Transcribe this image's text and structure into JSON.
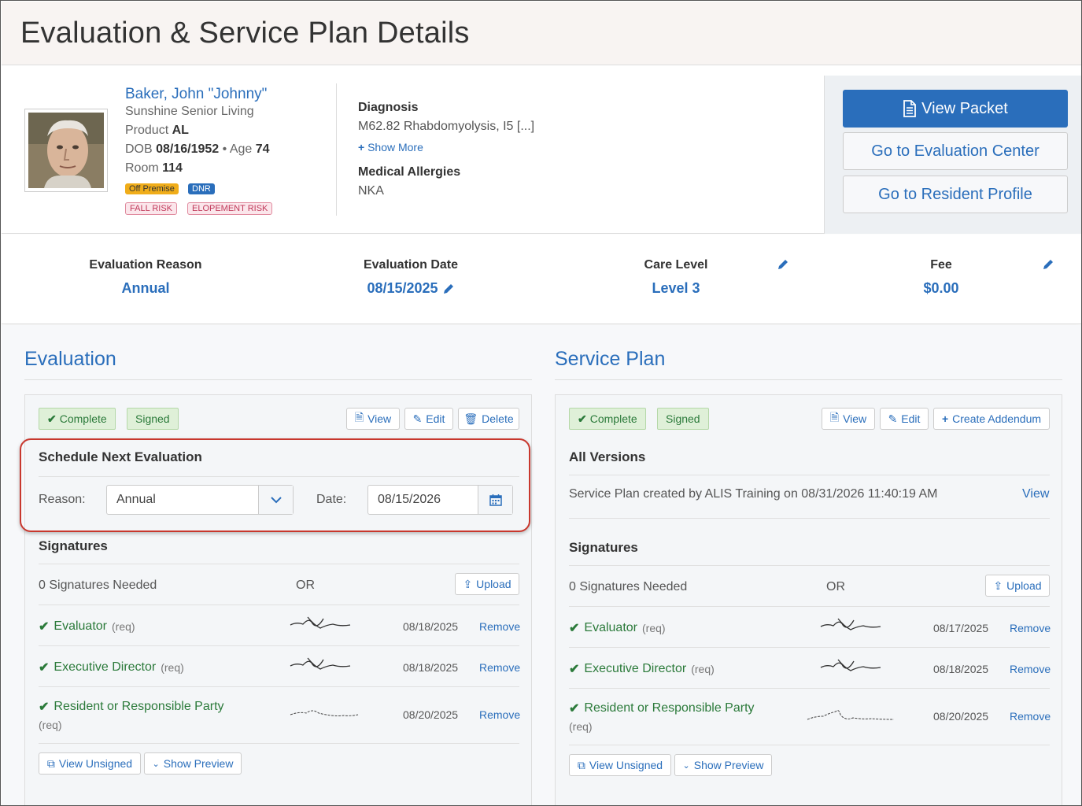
{
  "page": {
    "title": "Evaluation & Service Plan Details"
  },
  "resident": {
    "name": "Baker, John \"Johnny\"",
    "community": "Sunshine Senior Living",
    "product_label": "Product",
    "product": "AL",
    "dob_label": "DOB",
    "dob": "08/16/1952",
    "age_label": "Age",
    "age": "74",
    "room_label": "Room",
    "room": "114",
    "badges": [
      "Off Premise",
      "DNR",
      "FALL RISK",
      "ELOPEMENT RISK"
    ],
    "diagnosis_label": "Diagnosis",
    "diagnosis": "M62.82 Rhabdomyolysis, I5 [...]",
    "show_more": "Show More",
    "allergies_label": "Medical Allergies",
    "allergies": "NKA"
  },
  "actions": {
    "view_packet": "View Packet",
    "evaluation_center": "Go to Evaluation Center",
    "resident_profile": "Go to Resident Profile"
  },
  "summary": {
    "reason_label": "Evaluation Reason",
    "reason": "Annual",
    "date_label": "Evaluation Date",
    "date": "08/15/2025",
    "care_label": "Care Level",
    "care": "Level 3",
    "fee_label": "Fee",
    "fee": "$0.00"
  },
  "evaluation": {
    "title": "Evaluation",
    "tag_complete": "Complete",
    "tag_signed": "Signed",
    "btn_view": "View",
    "btn_edit": "Edit",
    "btn_delete": "Delete",
    "schedule_title": "Schedule Next Evaluation",
    "reason_label": "Reason:",
    "reason_value": "Annual",
    "date_label": "Date:",
    "date_value": "08/15/2026",
    "signatures_title": "Signatures",
    "needed": "0 Signatures Needed",
    "or": "OR",
    "upload": "Upload",
    "signers": [
      {
        "role": "Evaluator",
        "req": "(req)",
        "date": "08/18/2025",
        "remove": "Remove"
      },
      {
        "role": "Executive Director",
        "req": "(req)",
        "date": "08/18/2025",
        "remove": "Remove"
      },
      {
        "role": "Resident or Responsible Party",
        "req": "(req)",
        "date": "08/20/2025",
        "remove": "Remove"
      }
    ],
    "view_unsigned": "View Unsigned",
    "show_preview": "Show Preview"
  },
  "service_plan": {
    "title": "Service Plan",
    "tag_complete": "Complete",
    "tag_signed": "Signed",
    "btn_view": "View",
    "btn_edit": "Edit",
    "btn_addendum": "Create Addendum",
    "versions_title": "All Versions",
    "version_text": "Service Plan created by ALIS Training on 08/31/2026 11:40:19 AM",
    "version_view": "View",
    "signatures_title": "Signatures",
    "needed": "0 Signatures Needed",
    "or": "OR",
    "upload": "Upload",
    "signers": [
      {
        "role": "Evaluator",
        "req": "(req)",
        "date": "08/17/2025",
        "remove": "Remove"
      },
      {
        "role": "Executive Director",
        "req": "(req)",
        "date": "08/18/2025",
        "remove": "Remove"
      },
      {
        "role": "Resident or Responsible Party",
        "req": "(req)",
        "date": "08/20/2025",
        "remove": "Remove"
      }
    ],
    "view_unsigned": "View Unsigned",
    "show_preview": "Show Preview"
  },
  "colors": {
    "accent": "#2a6ebb",
    "success": "#2b7a3a",
    "highlight": "#c8372d"
  }
}
